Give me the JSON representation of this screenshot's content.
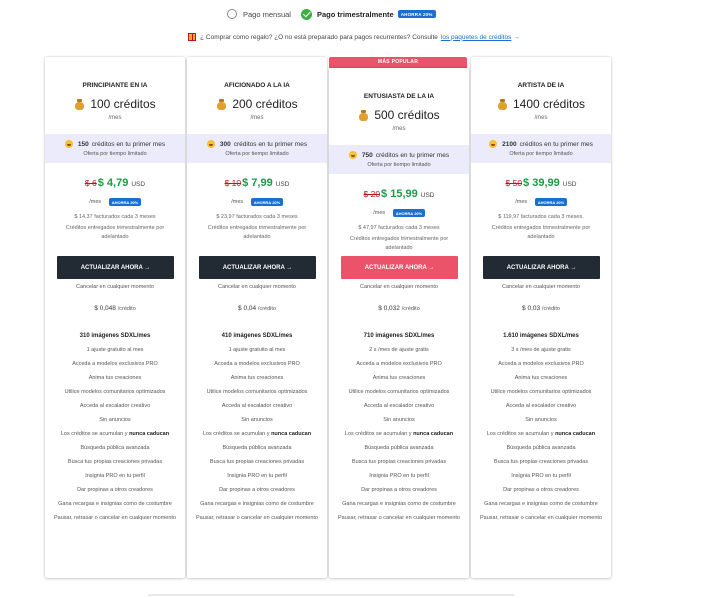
{
  "billing": {
    "monthly_label": "Pago mensual",
    "quarterly_label": "Pago trimestralmente",
    "quarterly_badge": "AHORRA 20%"
  },
  "gift": {
    "text": "¿ Comprar como regalo? ¿O no está preparado para pagos recurrentes? Consulte",
    "link": "los paquetes de créditos",
    "link_arrow": "→"
  },
  "popular_label": "MÁS POPULAR",
  "plans": [
    {
      "tier": "PRINCIPIANTE EN IA",
      "credits": "100 créditos",
      "per": "/mes",
      "bonus_amount": "150",
      "bonus_text": "créditos en tu primer mes",
      "bonus_sub": "Oferta por tiempo limitado",
      "old_price": "$ 6",
      "new_price": "$ 4,79",
      "currency": "USD",
      "per_month": "/mes",
      "badge": "AHORRA 20%",
      "billed": "$ 14,37 facturados cada 3 meses",
      "quarterly": "Créditos entregados trimestralmente por adelantado",
      "cta": "ACTUALIZAR AHORA →",
      "cancel": "Cancelar en cualquier momento",
      "per_credit_value": "$ 0,048",
      "per_credit_unit": "/crédito",
      "features": [
        {
          "text": "310 imágenes SDXL/mes",
          "bold": true
        },
        {
          "text": "1 ajuste gratuito al mes"
        },
        {
          "text": "Acceda a modelos exclusivos PRO"
        },
        {
          "text": "Anima tus creaciones"
        },
        {
          "text": "Utilice modelos comunitarios optimizados"
        },
        {
          "text": "Acceda al escalador creativo"
        },
        {
          "text": "Sin anuncios"
        },
        {
          "text": "Los créditos se acumulan y nunca caducan",
          "nunca": true
        },
        {
          "text": "Búsqueda pública avanzada"
        },
        {
          "text": "Busca tus propias creaciones privadas"
        },
        {
          "text": "Insignia PRO en tu perfil"
        },
        {
          "text": "Dar propinas a otros creadores"
        },
        {
          "text": "Gana recargas e insignias como de costumbre"
        },
        {
          "text": "Pausar, retrasar o cancelar en cualquier momento"
        }
      ]
    },
    {
      "tier": "AFICIONADO A LA IA",
      "credits": "200 créditos",
      "per": "/mes",
      "bonus_amount": "300",
      "bonus_text": "créditos en tu primer mes",
      "bonus_sub": "Oferta por tiempo limitado",
      "old_price": "$ 10",
      "new_price": "$ 7,99",
      "currency": "USD",
      "per_month": "/mes",
      "badge": "AHORRA 20%",
      "billed": "$ 23,97 facturados cada 3 meses",
      "quarterly": "Créditos entregados trimestralmente por adelantado",
      "cta": "ACTUALIZAR AHORA →",
      "cancel": "Cancelar en cualquier momento",
      "per_credit_value": "$ 0,04",
      "per_credit_unit": "/crédito",
      "features": [
        {
          "text": "410 imágenes SDXL/mes",
          "bold": true
        },
        {
          "text": "1 ajuste gratuito al mes"
        },
        {
          "text": "Acceda a modelos exclusivos PRO"
        },
        {
          "text": "Anima tus creaciones"
        },
        {
          "text": "Utilice modelos comunitarios optimizados"
        },
        {
          "text": "Acceda al escalador creativo"
        },
        {
          "text": "Sin anuncios"
        },
        {
          "text": "Los créditos se acumulan y nunca caducan",
          "nunca": true
        },
        {
          "text": "Búsqueda pública avanzada"
        },
        {
          "text": "Busca tus propias creaciones privadas"
        },
        {
          "text": "Insignia PRO en tu perfil"
        },
        {
          "text": "Dar propinas a otros creadores"
        },
        {
          "text": "Gana recargas e insignias como de costumbre"
        },
        {
          "text": "Pausar, retrasar o cancelar en cualquier momento"
        }
      ]
    },
    {
      "tier": "ENTUSIASTA DE LA IA",
      "credits": "500 créditos",
      "per": "/mes",
      "bonus_amount": "750",
      "bonus_text": "créditos en tu primer mes",
      "bonus_sub": "Oferta por tiempo limitado",
      "old_price": "$ 20",
      "new_price": "$ 15,99",
      "currency": "USD",
      "per_month": "/mes",
      "badge": "AHORRA 20%",
      "billed": "$ 47,97 facturados cada 3 meses",
      "quarterly": "Créditos entregados trimestralmente por adelantado",
      "cta": "ACTUALIZAR AHORA →",
      "cancel": "Cancelar en cualquier momento",
      "per_credit_value": "$ 0,032",
      "per_credit_unit": "/crédito",
      "features": [
        {
          "text": "710 imágenes SDXL/mes",
          "bold": true
        },
        {
          "text": "2 s /mes de ajuste gratis"
        },
        {
          "text": "Acceda a modelos exclusivos PRO"
        },
        {
          "text": "Anima tus creaciones"
        },
        {
          "text": "Utilice modelos comunitarios optimizados"
        },
        {
          "text": "Acceda al escalador creativo"
        },
        {
          "text": "Sin anuncios"
        },
        {
          "text": "Los créditos se acumulan y nunca caducan",
          "nunca": true
        },
        {
          "text": "Búsqueda pública avanzada"
        },
        {
          "text": "Busca tus propias creaciones privadas"
        },
        {
          "text": "Insignia PRO en tu perfil"
        },
        {
          "text": "Dar propinas a otros creadores"
        },
        {
          "text": "Gana recargas e insignias como de costumbre"
        },
        {
          "text": "Pausar, retrasar o cancelar en cualquier momento"
        }
      ]
    },
    {
      "tier": "ARTISTA DE IA",
      "credits": "1400 créditos",
      "per": "/mes",
      "bonus_amount": "2100",
      "bonus_text": "créditos en tu primer mes",
      "bonus_sub": "Oferta por tiempo limitado",
      "old_price": "$ 50",
      "new_price": "$ 39,99",
      "currency": "USD",
      "per_month": "/mes",
      "badge": "AHORRA 20%",
      "billed": "$ 119,97 facturados cada 3 meses.",
      "quarterly": "Créditos entregados trimestralmente por adelantado",
      "cta": "ACTUALIZAR AHORA →",
      "cancel": "Cancelar en cualquier momento",
      "per_credit_value": "$ 0,03",
      "per_credit_unit": "/crédito",
      "features": [
        {
          "text": "1.610 imágenes SDXL/mes",
          "bold": true
        },
        {
          "text": "3 s /mes de ajuste gratis"
        },
        {
          "text": "Acceda a modelos exclusivos PRO"
        },
        {
          "text": "Anima tus creaciones"
        },
        {
          "text": "Utilice modelos comunitarios optimizados"
        },
        {
          "text": "Acceda al escalador creativo"
        },
        {
          "text": "Sin anuncios"
        },
        {
          "text": "Los créditos se acumulan y nunca caducan",
          "nunca": true
        },
        {
          "text": "Búsqueda pública avanzada"
        },
        {
          "text": "Busca tus propias creaciones privadas"
        },
        {
          "text": "Insignia PRO en tu perfil"
        },
        {
          "text": "Dar propinas a otros creadores"
        },
        {
          "text": "Gana recargas e insignias como de costumbre"
        },
        {
          "text": "Pausar, retrasar o cancelar en cualquier momento"
        }
      ]
    }
  ],
  "colors": {
    "accent_blue": "#1a6fd0",
    "popular_pink": "#ea5369",
    "price_green": "#1e9a43",
    "strike_red": "#c1121f",
    "cta_dark": "#222a33",
    "bonus_bg": "#ecebfb"
  }
}
